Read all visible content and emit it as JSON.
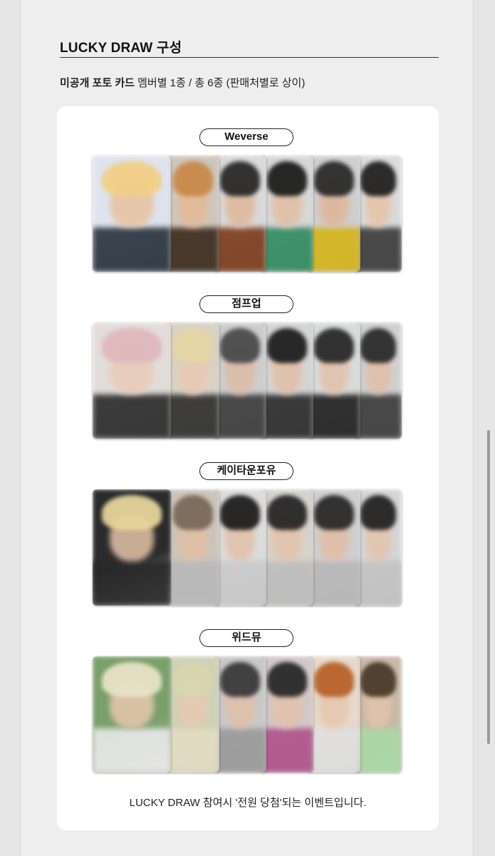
{
  "section": {
    "title": "LUCKY DRAW 구성",
    "subtitle_bold": "미공개 포토 카드",
    "subtitle_rest": " 멤버별 1종 / 총 6종 (판매처별로 상이)"
  },
  "groups": [
    {
      "label": "Weverse"
    },
    {
      "label": "점프업"
    },
    {
      "label": "케이타운포유"
    },
    {
      "label": "위드뮤"
    }
  ],
  "footer": {
    "note": "LUCKY DRAW 참여시 '전원 당첨'되는 이벤트입니다."
  },
  "colors": {
    "accent_border": "#222222",
    "card_bg": "#ffffff",
    "page_bg": "#eeeeee"
  },
  "photo_icon": "blurred-photocard-image"
}
